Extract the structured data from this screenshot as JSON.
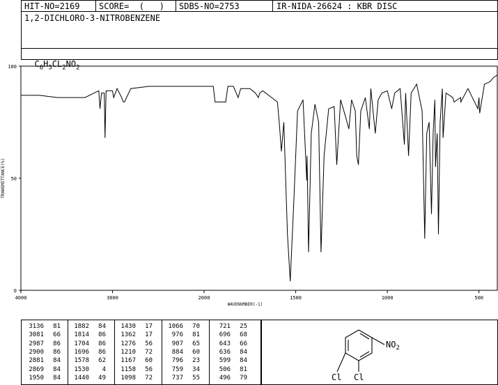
{
  "header": {
    "hit_no": "HIT-NO=2169",
    "score": "SCORE=  (   )",
    "sdbs_no": "SDBS-NO=2753",
    "ir_no": "IR-NIDA-26624 : KBR DISC",
    "compound_name": "1,2-DICHLORO-3-NITROBENZENE",
    "formula_parts": [
      "C",
      "6",
      "H",
      "3",
      "CL",
      "2",
      "NO",
      "2"
    ]
  },
  "chart_data": {
    "type": "line",
    "xlabel": "WAVENUMBER(-1)",
    "ylabel": "TRANSMITTANCE(%)",
    "xlim": [
      4000,
      400
    ],
    "ylim": [
      0,
      100
    ],
    "x_ticks": [
      4000,
      3000,
      2000,
      1500,
      1000,
      500
    ],
    "y_ticks": [
      0,
      50,
      100
    ],
    "series": [
      {
        "x": [
          4000,
          3800,
          3600,
          3400,
          3300,
          3200,
          3150,
          3136,
          3120,
          3090,
          3081,
          3070,
          3000,
          2987,
          2950,
          2900,
          2881,
          2869,
          2800,
          2600,
          2400,
          2200,
          2000,
          1960,
          1950,
          1940,
          1882,
          1870,
          1840,
          1814,
          1800,
          1750,
          1720,
          1704,
          1696,
          1680,
          1600,
          1590,
          1578,
          1565,
          1545,
          1530,
          1510,
          1490,
          1460,
          1440,
          1438,
          1430,
          1415,
          1395,
          1375,
          1362,
          1345,
          1320,
          1290,
          1276,
          1255,
          1230,
          1210,
          1195,
          1175,
          1167,
          1158,
          1145,
          1120,
          1098,
          1090,
          1066,
          1050,
          1030,
          1000,
          976,
          960,
          930,
          907,
          900,
          884,
          870,
          840,
          810,
          796,
          785,
          772,
          759,
          750,
          741,
          737,
          728,
          721,
          712,
          700,
          696,
          680,
          643,
          636,
          600,
          599,
          560,
          506,
          500,
          496,
          470,
          440,
          420,
          400
        ],
        "y": [
          87,
          87,
          86,
          86,
          86,
          88,
          89,
          81,
          88,
          88,
          68,
          89,
          89,
          86,
          90,
          86,
          84,
          84,
          90,
          91,
          91,
          91,
          91,
          91,
          91,
          84,
          84,
          91,
          91,
          86,
          90,
          90,
          88,
          86,
          88,
          89,
          84,
          75,
          62,
          75,
          25,
          4,
          40,
          80,
          85,
          49,
          60,
          17,
          70,
          83,
          75,
          17,
          60,
          81,
          82,
          56,
          85,
          78,
          72,
          85,
          80,
          60,
          56,
          80,
          86,
          72,
          90,
          70,
          85,
          88,
          89,
          81,
          88,
          90,
          65,
          88,
          60,
          88,
          92,
          80,
          23,
          70,
          75,
          34,
          70,
          85,
          55,
          70,
          25,
          75,
          90,
          68,
          88,
          86,
          84,
          86,
          84,
          90,
          81,
          86,
          79,
          92,
          93,
          95,
          96
        ]
      }
    ]
  },
  "peak_table": [
    [
      [
        "3136",
        "81"
      ],
      [
        "3081",
        "66"
      ],
      [
        "2987",
        "86"
      ],
      [
        "2900",
        "86"
      ],
      [
        "2881",
        "84"
      ],
      [
        "2869",
        "84"
      ],
      [
        "1950",
        "84"
      ]
    ],
    [
      [
        "1882",
        "84"
      ],
      [
        "1814",
        "86"
      ],
      [
        "1704",
        "86"
      ],
      [
        "1696",
        "86"
      ],
      [
        "1578",
        "62"
      ],
      [
        "1530",
        "4"
      ],
      [
        "1440",
        "49"
      ]
    ],
    [
      [
        "1430",
        "17"
      ],
      [
        "1362",
        "17"
      ],
      [
        "1276",
        "56"
      ],
      [
        "1210",
        "72"
      ],
      [
        "1167",
        "60"
      ],
      [
        "1158",
        "56"
      ],
      [
        "1098",
        "72"
      ]
    ],
    [
      [
        "1066",
        "70"
      ],
      [
        "976",
        "81"
      ],
      [
        "907",
        "65"
      ],
      [
        "884",
        "60"
      ],
      [
        "796",
        "23"
      ],
      [
        "759",
        "34"
      ],
      [
        "737",
        "55"
      ]
    ],
    [
      [
        "721",
        "25"
      ],
      [
        "696",
        "68"
      ],
      [
        "643",
        "66"
      ],
      [
        "636",
        "84"
      ],
      [
        "599",
        "84"
      ],
      [
        "506",
        "81"
      ],
      [
        "496",
        "79"
      ]
    ]
  ],
  "structure": {
    "no2_main": "NO",
    "no2_sub": "2",
    "cl1": "Cl",
    "cl2": "Cl"
  }
}
